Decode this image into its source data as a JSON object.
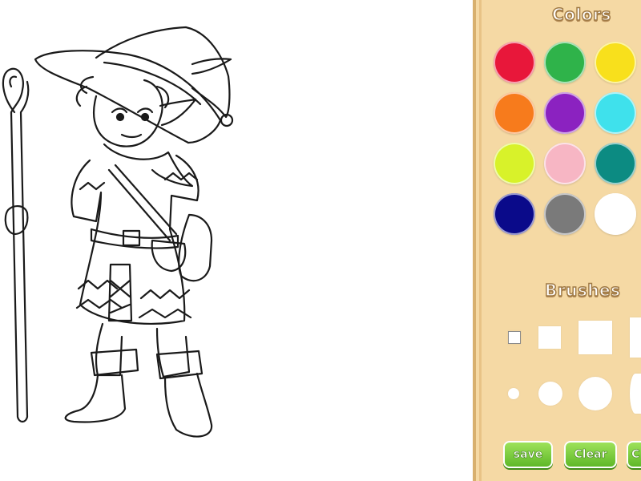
{
  "panel": {
    "colors_title": "Colors",
    "brushes_title": "Brushes",
    "colors": [
      {
        "name": "red",
        "hex": "#e8173a"
      },
      {
        "name": "green",
        "hex": "#2fb34a"
      },
      {
        "name": "yellow",
        "hex": "#f8e01c"
      },
      {
        "name": "orange",
        "hex": "#f77b1c"
      },
      {
        "name": "purple",
        "hex": "#8b22c0"
      },
      {
        "name": "cyan",
        "hex": "#3fe1ec"
      },
      {
        "name": "lime",
        "hex": "#d8f22a"
      },
      {
        "name": "pink",
        "hex": "#f7b6c4"
      },
      {
        "name": "teal",
        "hex": "#0c8b82"
      },
      {
        "name": "navy",
        "hex": "#0a0a8a"
      },
      {
        "name": "gray",
        "hex": "#7a7a7a"
      },
      {
        "name": "white",
        "hex": "#ffffff"
      }
    ],
    "buttons": {
      "save_label": "save",
      "clear_label": "Clear",
      "third_label": "C"
    }
  }
}
